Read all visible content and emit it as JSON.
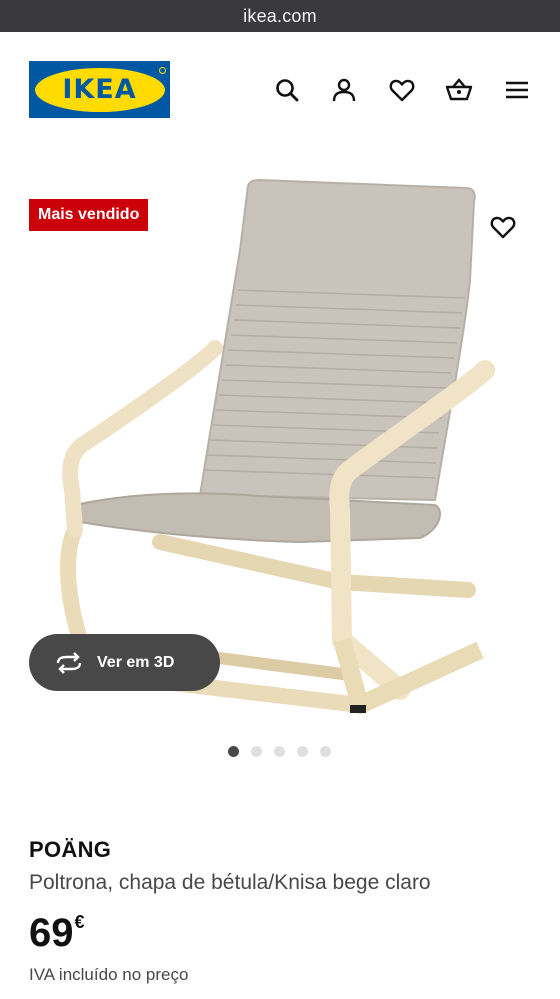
{
  "browser": {
    "url": "ikea.com"
  },
  "header": {
    "logo_text": "IKEA",
    "icons": [
      "search-icon",
      "user-icon",
      "heart-icon",
      "basket-icon",
      "menu-icon"
    ]
  },
  "gallery": {
    "badge": "Mais vendido",
    "view_3d_label": "Ver em 3D",
    "carousel": {
      "total": 5,
      "active": 1
    }
  },
  "product": {
    "name": "POÄNG",
    "description": "Poltrona, chapa de bétula/Knisa bege claro",
    "price": "69",
    "currency": "€",
    "vat_note": "IVA incluído no preço"
  },
  "colors": {
    "ikea_blue": "#0058a3",
    "ikea_yellow": "#ffdb00",
    "badge_red": "#cc0008",
    "button_dark": "#484848"
  }
}
